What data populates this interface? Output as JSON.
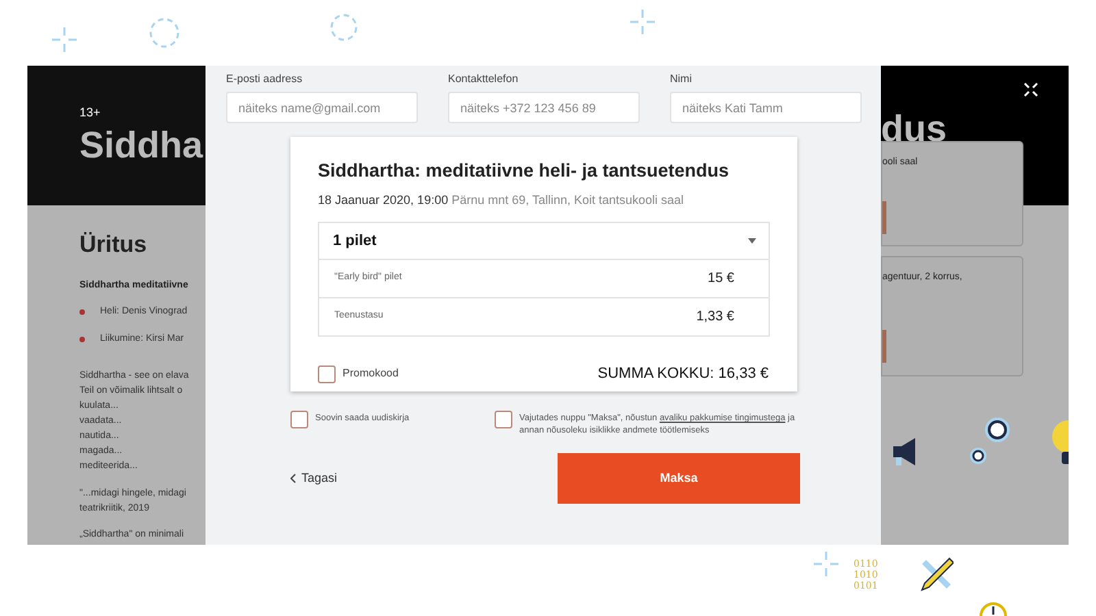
{
  "background_page": {
    "age_rating": "13+",
    "title_left": "Siddha",
    "title_right": "dus",
    "section_title": "Üritus",
    "intro": "Siddhartha meditatiivne",
    "bullets": [
      "Heli: Denis Vinograd",
      "Liikumine: Kirsi Mar"
    ],
    "paragraph_lines": [
      "Siddhartha - see on elava",
      "Teil on võimalik lihtsalt o",
      "kuulata...",
      "vaadata...",
      "nautida...",
      "magada...",
      "mediteerida..."
    ],
    "quote_lines": [
      "\"...midagi hingele, midagi",
      "teatrikriitik, 2019"
    ],
    "last_line": "„Siddhartha\" on minimali",
    "cards": [
      {
        "text": "ooli saal"
      },
      {
        "text": "agentuur, 2 korrus,"
      }
    ]
  },
  "modal": {
    "fields": [
      {
        "label": "E-posti aadress",
        "placeholder": "näiteks name@gmail.com"
      },
      {
        "label": "Kontakttelefon",
        "placeholder": "näiteks +372 123 456 89"
      },
      {
        "label": "Nimi",
        "placeholder": "näiteks Kati Tamm"
      }
    ],
    "event": {
      "title": "Siddhartha: meditatiivne heli- ja tantsuetendus",
      "datetime": "18 Jaanuar 2020, 19:00",
      "location": "Pärnu mnt 69, Tallinn, Koit tantsukooli saal"
    },
    "ticket_select": {
      "value": "1 pilet"
    },
    "price_rows": [
      {
        "label": "\"Early bird\" pilet",
        "price": "15 €"
      },
      {
        "label": "Teenustasu",
        "price": "1,33 €"
      }
    ],
    "promo": {
      "label": "Promokood",
      "checked": false
    },
    "total": "SUMMA KOKKU: 16,33 €",
    "consents": [
      {
        "checked": false,
        "text": "Soovin saada uudiskirja"
      },
      {
        "checked": false,
        "text": "Vajutades nuppu \"Maksa\", nõustun ",
        "link": "avaliku pakkumise tingimustega",
        "text_after": " ja annan nõusoleku isiklikke andmete töötlemiseks"
      }
    ],
    "back_link": "Tagasi",
    "pay_button": "Maksa"
  },
  "decor": {
    "binary_lines": [
      "0110",
      "1010",
      "0101"
    ]
  }
}
